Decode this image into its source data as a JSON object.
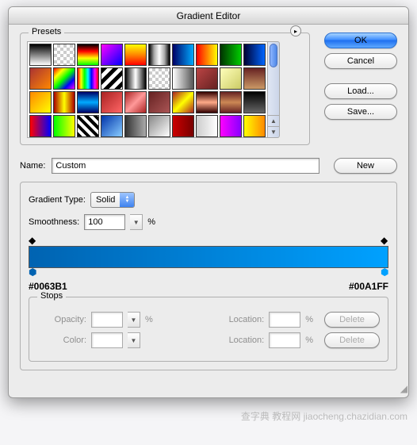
{
  "title": "Gradient Editor",
  "presets": {
    "legend": "Presets",
    "swatches": [
      "linear-gradient(to bottom,#000,#fff)",
      "repeating-conic-gradient(#ccc 0 25%,#fff 0 50%) 0 0/8px 8px, linear-gradient(to right,#000,#fff)",
      "linear-gradient(to bottom,#000,#f00,#ff0,#0f0)",
      "linear-gradient(135deg,#f0f,#00f)",
      "linear-gradient(to bottom,#ff0,#f80,#f00)",
      "linear-gradient(to right,#000,#aaa,#fff,#aaa,#000)",
      "linear-gradient(to right,#006,#0af)",
      "linear-gradient(to right,#f00,#ff0)",
      "linear-gradient(to right,#030,#0c0)",
      "linear-gradient(to right,#003,#06f)",
      "linear-gradient(135deg,#a33,#f80)",
      "linear-gradient(135deg,#f00,#ff0,#0f0,#00f,#f0f)",
      "linear-gradient(to right,#f00,#ff0,#0f0,#0ff,#00f,#f0f,#f00)",
      "repeating-linear-gradient(135deg,#000 0 5px,#fff 5px 10px)",
      "linear-gradient(to right,#000,#fff,#000)",
      "repeating-conic-gradient(#ccc 0 25%,#fff 0 50%) 0 0/8px 8px",
      "linear-gradient(to right,#fff,#555)",
      "linear-gradient(135deg,#b44,#622)",
      "linear-gradient(135deg,#ffb,#cc6)",
      "linear-gradient(to bottom,#622,#c96)",
      "linear-gradient(135deg,#f80,#ff0)",
      "linear-gradient(to right,#a00,#ff0,#a00)",
      "linear-gradient(to bottom,#006,#0af,#006)",
      "linear-gradient(135deg,#a22,#f66)",
      "linear-gradient(135deg,#a22,#f99,#a22)",
      "linear-gradient(135deg,#622,#a55)",
      "linear-gradient(135deg,#a22,#ff0,#a22)",
      "linear-gradient(to bottom,#300,#fa8,#300)",
      "linear-gradient(to bottom,#622,#c85,#622)",
      "linear-gradient(to bottom,#000,#666)",
      "linear-gradient(to right,#f00,#00f)",
      "linear-gradient(to right,#0f0,#ff0)",
      "repeating-linear-gradient(45deg,#000 0 4px,#fff 4px 8px)",
      "linear-gradient(135deg,#0033aa,#88ccff)",
      "linear-gradient(to right,#333,#aaa)",
      "linear-gradient(135deg,#888,#fff)",
      "linear-gradient(to right,#c00,#700)",
      "linear-gradient(to right,#ccc,#fff)",
      "linear-gradient(to right,#f0f,#80f)",
      "linear-gradient(to right,#ff0,#f80)"
    ]
  },
  "buttons": {
    "ok": "OK",
    "cancel": "Cancel",
    "load": "Load...",
    "save": "Save...",
    "new": "New",
    "delete": "Delete"
  },
  "name": {
    "label": "Name:",
    "value": "Custom"
  },
  "gradientType": {
    "label": "Gradient Type:",
    "value": "Solid"
  },
  "smoothness": {
    "label": "Smoothness:",
    "value": "100",
    "unit": "%"
  },
  "gradient": {
    "startColor": "#0063B1",
    "endColor": "#00A1FF"
  },
  "stops": {
    "legend": "Stops",
    "opacityLabel": "Opacity:",
    "colorLabel": "Color:",
    "locationLabel": "Location:",
    "unit": "%",
    "opacityValue": "",
    "locationValue1": "",
    "locationValue2": ""
  },
  "watermark": "查字典 教程网  jiaocheng.chazidian.com"
}
